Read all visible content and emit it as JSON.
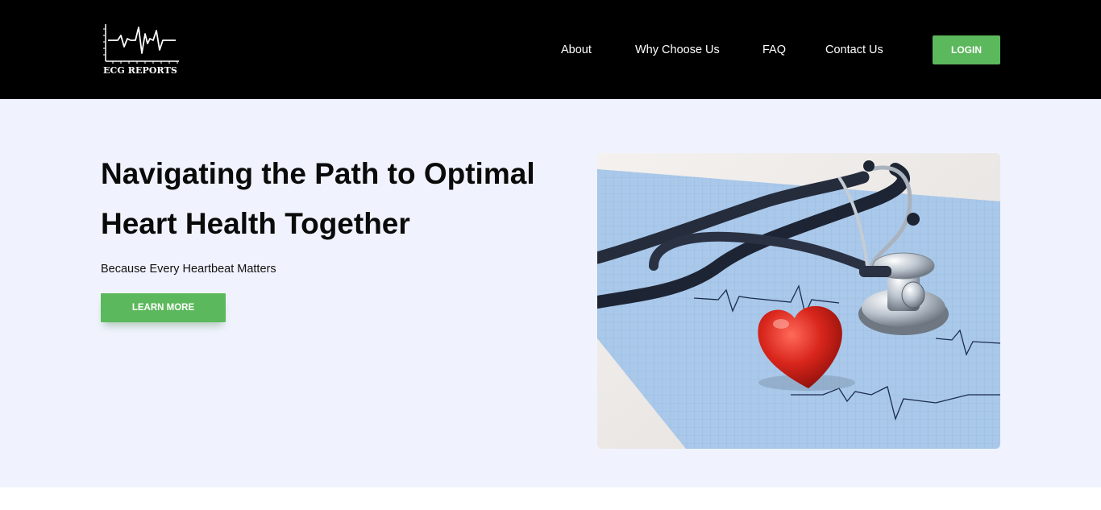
{
  "header": {
    "logo_text": "ECG REPORTS",
    "logo_icon": "ecg-waveform-icon",
    "nav": [
      {
        "label": "About"
      },
      {
        "label": "Why Choose Us"
      },
      {
        "label": "FAQ"
      },
      {
        "label": "Contact Us"
      }
    ],
    "login_label": "LOGIN"
  },
  "hero": {
    "title": "Navigating the Path to Optimal Heart Health Together",
    "subtitle": "Because Every Heartbeat Matters",
    "cta_label": "LEARN MORE",
    "image_icon": "stethoscope-heart-photo"
  },
  "colors": {
    "header_bg": "#000000",
    "accent_green": "#5cb85c",
    "hero_bg": "#f0f3fd"
  }
}
